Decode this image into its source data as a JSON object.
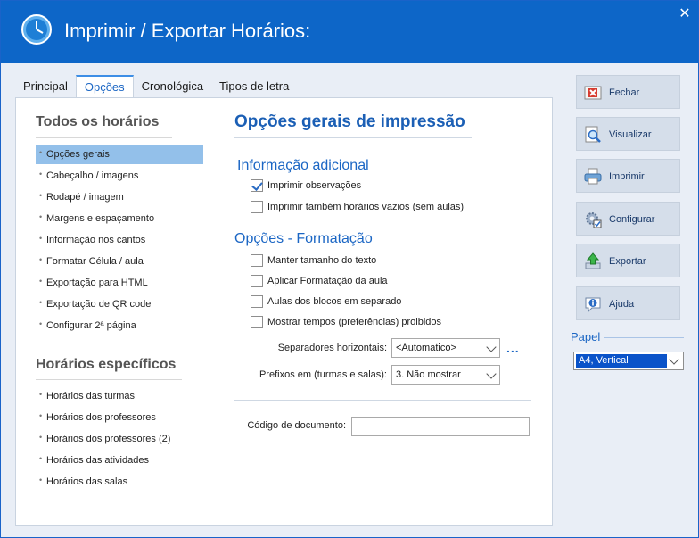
{
  "window": {
    "title": "Imprimir / Exportar Horários:",
    "close_icon": "close-icon"
  },
  "tabs": [
    {
      "label": "Principal"
    },
    {
      "label": "Opções",
      "active": true
    },
    {
      "label": "Cronológica"
    },
    {
      "label": "Tipos de letra"
    }
  ],
  "left": {
    "section1_title": "Todos os horários",
    "items1": [
      {
        "label": "Opções gerais",
        "selected": true
      },
      {
        "label": "Cabeçalho / imagens"
      },
      {
        "label": "Rodapé / imagem"
      },
      {
        "label": "Margens e espaçamento"
      },
      {
        "label": "Informação nos cantos"
      },
      {
        "label": "Formatar Célula / aula"
      },
      {
        "label": "Exportação para HTML"
      },
      {
        "label": "Exportação de QR code"
      },
      {
        "label": "Configurar 2ª página"
      }
    ],
    "section2_title": "Horários específicos",
    "items2": [
      {
        "label": "Horários das turmas"
      },
      {
        "label": "Horários dos professores"
      },
      {
        "label": "Horários dos professores (2)"
      },
      {
        "label": "Horários das atividades"
      },
      {
        "label": "Horários das salas"
      }
    ]
  },
  "main": {
    "heading": "Opções gerais de impressão",
    "info_heading": "Informação adicional",
    "info_checks": [
      {
        "label": "Imprimir observações",
        "checked": true
      },
      {
        "label": "Imprimir também horários vazios (sem aulas)",
        "checked": false
      }
    ],
    "format_heading": "Opções - Formatação",
    "format_checks": [
      {
        "label": "Manter tamanho do texto",
        "checked": false
      },
      {
        "label": "Aplicar Formatação da aula",
        "checked": false
      },
      {
        "label": "Aulas dos blocos em separado",
        "checked": false
      },
      {
        "label": "Mostrar tempos (preferências) proibidos",
        "checked": false
      }
    ],
    "separators_label": "Separadores horizontais:",
    "separators_value": "<Automatico>",
    "dots_label": "...",
    "prefixes_label": "Prefixos em (turmas e salas):",
    "prefixes_value": "3. Não mostrar",
    "doc_code_label": "Código de documento:",
    "doc_code_value": ""
  },
  "side": {
    "buttons": [
      {
        "label": "Fechar",
        "icon": "close-doc-icon"
      },
      {
        "label": "Visualizar",
        "icon": "preview-icon"
      },
      {
        "label": "Imprimir",
        "icon": "printer-icon"
      },
      {
        "label": "Configurar",
        "icon": "settings-icon"
      },
      {
        "label": "Exportar",
        "icon": "export-icon"
      },
      {
        "label": "Ajuda",
        "icon": "help-icon"
      }
    ],
    "paper_label": "Papel",
    "paper_value": "A4, Vertical"
  },
  "colors": {
    "titlebar": "#0d66c8",
    "accent": "#1b66c4",
    "selection": "#93c0ea",
    "paper_selection": "#0a53c9"
  }
}
